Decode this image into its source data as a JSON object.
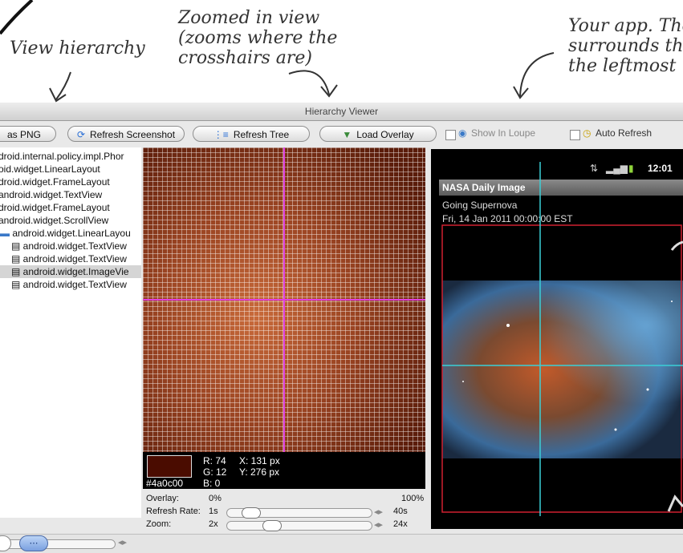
{
  "annotations": {
    "view_hierarchy": "View hierarchy",
    "zoomed_view": "Zoomed in view\n(zooms where the\ncrosshairs are)",
    "your_app": "Your app. The\nsurrounds the\nthe leftmost"
  },
  "window": {
    "title": "Hierarchy Viewer"
  },
  "toolbar": {
    "save_png_label": "as PNG",
    "refresh_screenshot_label": "Refresh Screenshot",
    "refresh_tree_label": "Refresh Tree",
    "load_overlay_label": "Load Overlay",
    "show_in_loupe_label": "Show In Loupe",
    "auto_refresh_label": "Auto Refresh"
  },
  "tree": {
    "items": [
      {
        "label": "droid.internal.policy.impl.Phor"
      },
      {
        "label": "oid.widget.LinearLayout"
      },
      {
        "label": "droid.widget.FrameLayout"
      },
      {
        "label": "android.widget.TextView"
      },
      {
        "label": "droid.widget.FrameLayout"
      },
      {
        "label": "android.widget.ScrollView"
      },
      {
        "label": "android.widget.LinearLayou"
      },
      {
        "label": "android.widget.TextView"
      },
      {
        "label": "android.widget.TextView"
      },
      {
        "label": "android.widget.ImageVie"
      },
      {
        "label": "android.widget.TextView"
      }
    ]
  },
  "pixel_info": {
    "hex": "#4a0c00",
    "r_label": "R: 74",
    "g_label": "G: 12",
    "b_label": "B: 0",
    "x_label": "X: 131 px",
    "y_label": "Y: 276 px",
    "swatch_color": "#4a0c00"
  },
  "controls": {
    "overlay_label": "Overlay:",
    "overlay_min": "0%",
    "overlay_max": "100%",
    "refresh_rate_label": "Refresh Rate:",
    "refresh_rate_value": "1s",
    "refresh_rate_max": "40s",
    "zoom_label": "Zoom:",
    "zoom_value": "2x",
    "zoom_max": "24x"
  },
  "phone": {
    "clock": "12:01",
    "app_title": "NASA Daily Image",
    "image_title": "Going Supernova",
    "date": "Fri, 14 Jan 2011 00:00:00 EST"
  }
}
